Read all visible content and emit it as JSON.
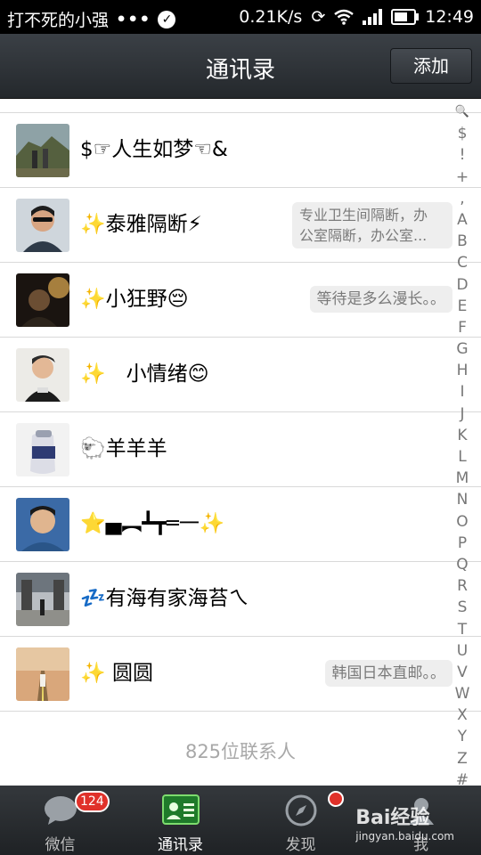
{
  "status_bar": {
    "carrier": "打不死的小强",
    "dots": "•••",
    "speed": "0.21K/s",
    "time": "12:49",
    "battery_level": 0.7
  },
  "header": {
    "title": "通讯录",
    "add_button": "添加"
  },
  "contacts": [
    {
      "name": "$☞人生如梦☜&",
      "signature": ""
    },
    {
      "name": "✨泰雅隔断⚡",
      "signature": "专业卫生间隔断，办\n公室隔断，办公室..."
    },
    {
      "name": "✨小狂野😔",
      "signature": "等待是多么漫长。。"
    },
    {
      "name": "✨　小情绪😊",
      "signature": ""
    },
    {
      "name": "🐑羊羊羊",
      "signature": ""
    },
    {
      "name": "⭐▄︻┻┳═一✨",
      "signature": ""
    },
    {
      "name": "💤有海有家海苔ㄟ",
      "signature": ""
    },
    {
      "name": "✨ 圆圆",
      "signature": "韩国日本直邮。。"
    }
  ],
  "contact_count": "825位联系人",
  "index": [
    "🔍",
    "$",
    "!",
    "+",
    ",",
    "A",
    "B",
    "C",
    "D",
    "E",
    "F",
    "G",
    "H",
    "I",
    "J",
    "K",
    "L",
    "M",
    "N",
    "O",
    "P",
    "Q",
    "R",
    "S",
    "T",
    "U",
    "V",
    "W",
    "X",
    "Y",
    "Z",
    "#"
  ],
  "bottom_nav": {
    "tabs": [
      {
        "label": "微信",
        "icon": "chat-bubble-icon",
        "badge": "124"
      },
      {
        "label": "通讯录",
        "icon": "contacts-card-icon",
        "active": true
      },
      {
        "label": "发现",
        "icon": "compass-icon",
        "dot": true
      },
      {
        "label": "我",
        "icon": "profile-icon"
      }
    ]
  },
  "watermark": {
    "text": "Bai经验",
    "url": "jingyan.baidu.com"
  }
}
